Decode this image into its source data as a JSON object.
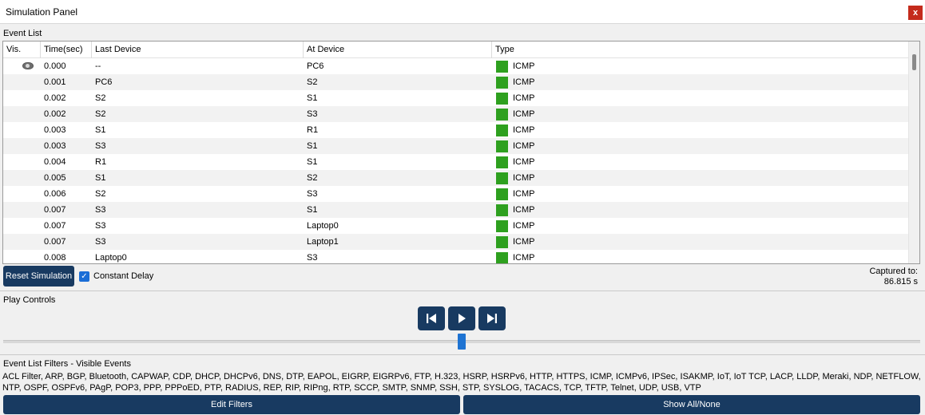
{
  "window": {
    "title": "Simulation Panel",
    "close_label": "x"
  },
  "event_list": {
    "label": "Event List",
    "columns": [
      "Vis.",
      "Time(sec)",
      "Last Device",
      "At Device",
      "Type"
    ],
    "rows": [
      {
        "vis": true,
        "time": "0.000",
        "last": "--",
        "at": "PC6",
        "type": "ICMP"
      },
      {
        "vis": false,
        "time": "0.001",
        "last": "PC6",
        "at": "S2",
        "type": "ICMP"
      },
      {
        "vis": false,
        "time": "0.002",
        "last": "S2",
        "at": "S1",
        "type": "ICMP"
      },
      {
        "vis": false,
        "time": "0.002",
        "last": "S2",
        "at": "S3",
        "type": "ICMP"
      },
      {
        "vis": false,
        "time": "0.003",
        "last": "S1",
        "at": "R1",
        "type": "ICMP"
      },
      {
        "vis": false,
        "time": "0.003",
        "last": "S3",
        "at": "S1",
        "type": "ICMP"
      },
      {
        "vis": false,
        "time": "0.004",
        "last": "R1",
        "at": "S1",
        "type": "ICMP"
      },
      {
        "vis": false,
        "time": "0.005",
        "last": "S1",
        "at": "S2",
        "type": "ICMP"
      },
      {
        "vis": false,
        "time": "0.006",
        "last": "S2",
        "at": "S3",
        "type": "ICMP"
      },
      {
        "vis": false,
        "time": "0.007",
        "last": "S3",
        "at": "S1",
        "type": "ICMP"
      },
      {
        "vis": false,
        "time": "0.007",
        "last": "S3",
        "at": "Laptop0",
        "type": "ICMP"
      },
      {
        "vis": false,
        "time": "0.007",
        "last": "S3",
        "at": "Laptop1",
        "type": "ICMP"
      },
      {
        "vis": false,
        "time": "0.008",
        "last": "Laptop0",
        "at": "S3",
        "type": "ICMP"
      }
    ],
    "type_color": "#2ea01f"
  },
  "controls": {
    "reset_label": "Reset Simulation",
    "constant_delay_label": "Constant Delay",
    "constant_delay_checked": true,
    "captured_label": "Captured to:",
    "captured_value": "86.815 s"
  },
  "play_controls": {
    "label": "Play Controls",
    "buttons": [
      "back-step-icon",
      "play-icon",
      "forward-step-icon"
    ]
  },
  "filters": {
    "label": "Event List Filters - Visible Events",
    "visible_events": "ACL Filter, ARP, BGP, Bluetooth, CAPWAP, CDP, DHCP, DHCPv6, DNS, DTP, EAPOL, EIGRP, EIGRPv6, FTP, H.323, HSRP, HSRPv6, HTTP, HTTPS, ICMP, ICMPv6, IPSec, ISAKMP, IoT, IoT TCP, LACP, LLDP, Meraki, NDP, NETFLOW, NTP, OSPF, OSPFv6, PAgP, POP3, PPP, PPPoED, PTP, RADIUS, REP, RIP, RIPng, RTP, SCCP, SMTP, SNMP, SSH, STP, SYSLOG, TACACS, TCP, TFTP, Telnet, UDP, USB, VTP",
    "edit_label": "Edit Filters",
    "show_all_label": "Show All/None"
  },
  "colors": {
    "accent_dark": "#183a61",
    "checkbox_blue": "#1a6dd6",
    "slider_blue": "#1e73d2"
  }
}
